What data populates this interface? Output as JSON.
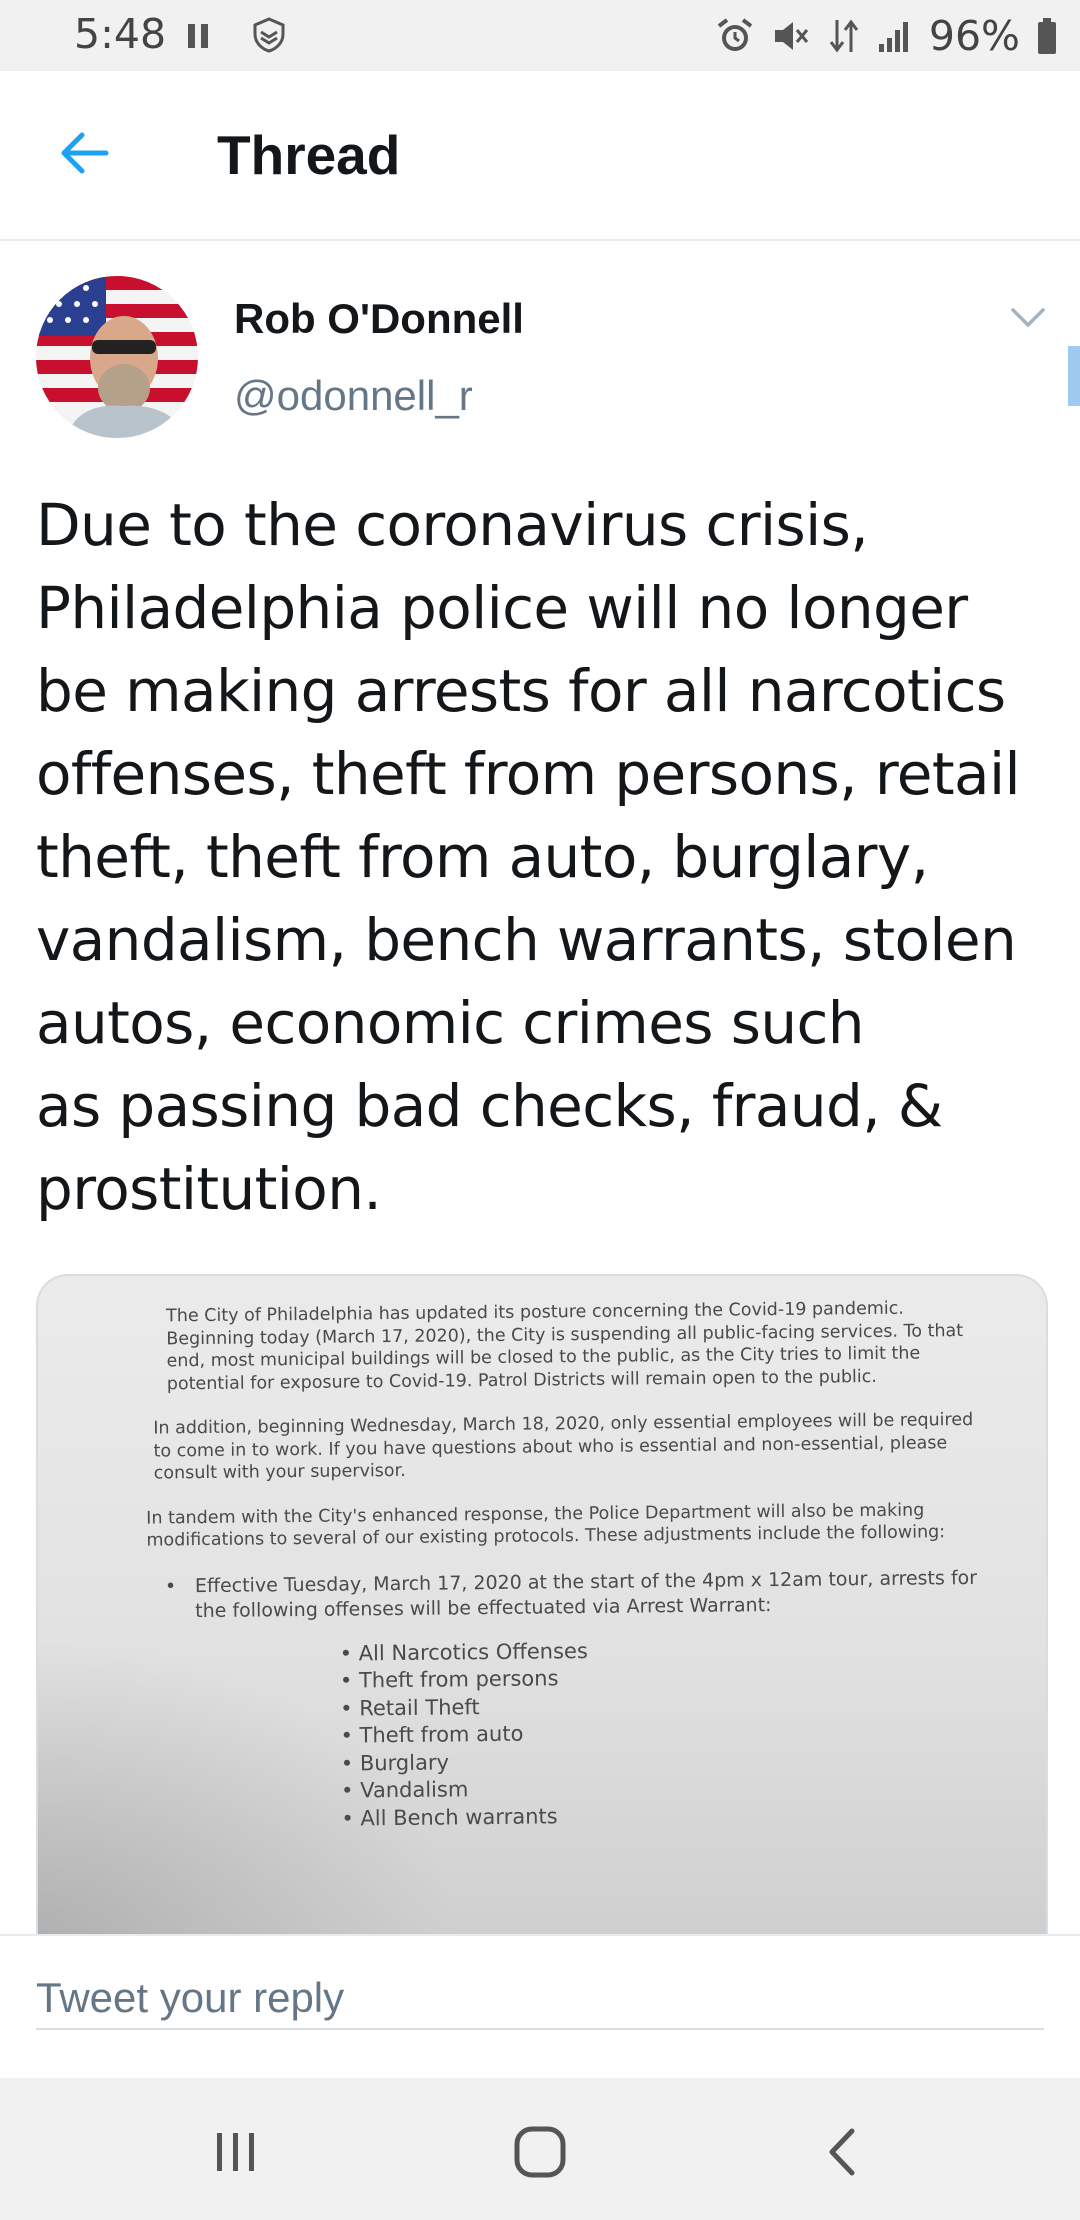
{
  "status_bar": {
    "time": "5:48",
    "battery": "96%",
    "icons": [
      "pause-icon",
      "shield-icon",
      "alarm-icon",
      "mute-icon",
      "data-icon",
      "signal-icon",
      "battery-icon"
    ]
  },
  "header": {
    "title": "Thread",
    "back_icon": "arrow-left-icon",
    "accent_color": "#1da1f2"
  },
  "tweet": {
    "author_name": "Rob O'Donnell",
    "author_handle": "@odonnell_r",
    "text": "Due to the coronavirus crisis,\nPhiladelphia police will no longer\nbe making arrests for all narcotics\noffenses, theft from persons, retail\ntheft, theft from auto, burglary,\nvandalism, bench warrants, stolen\nautos, economic crimes such\nas passing bad checks, fraud, &\nprostitution."
  },
  "media": {
    "paragraphs": [
      "The City of Philadelphia has updated its posture concerning the Covid-19 pandemic. Beginning today (March 17, 2020), the City is suspending all public-facing services. To that end, most municipal buildings will be closed to the public, as the City tries to limit the potential for exposure to Covid-19. Patrol Districts will remain open to the public.",
      "In addition, beginning Wednesday, March 18, 2020, only essential employees will be required to come in to work. If you have questions about who is essential and non-essential, please consult with your supervisor.",
      "In tandem with the City's enhanced response, the Police Department will also be making modifications to several of our existing protocols. These adjustments include the following:"
    ],
    "bullet": "Effective Tuesday, March 17, 2020 at the start of the 4pm x 12am tour, arrests for the following offenses will be effectuated via Arrest Warrant:",
    "offenses": [
      "All Narcotics Offenses",
      "Theft from persons",
      "Retail Theft",
      "Theft from auto",
      "Burglary",
      "Vandalism",
      "All Bench warrants"
    ]
  },
  "reply": {
    "placeholder": "Tweet your reply"
  },
  "nav_bar": {
    "buttons": [
      "recents-icon",
      "home-icon",
      "back-icon"
    ]
  },
  "colors": {
    "text_primary": "#14171a",
    "text_secondary": "#657786",
    "accent": "#1da1f2"
  }
}
